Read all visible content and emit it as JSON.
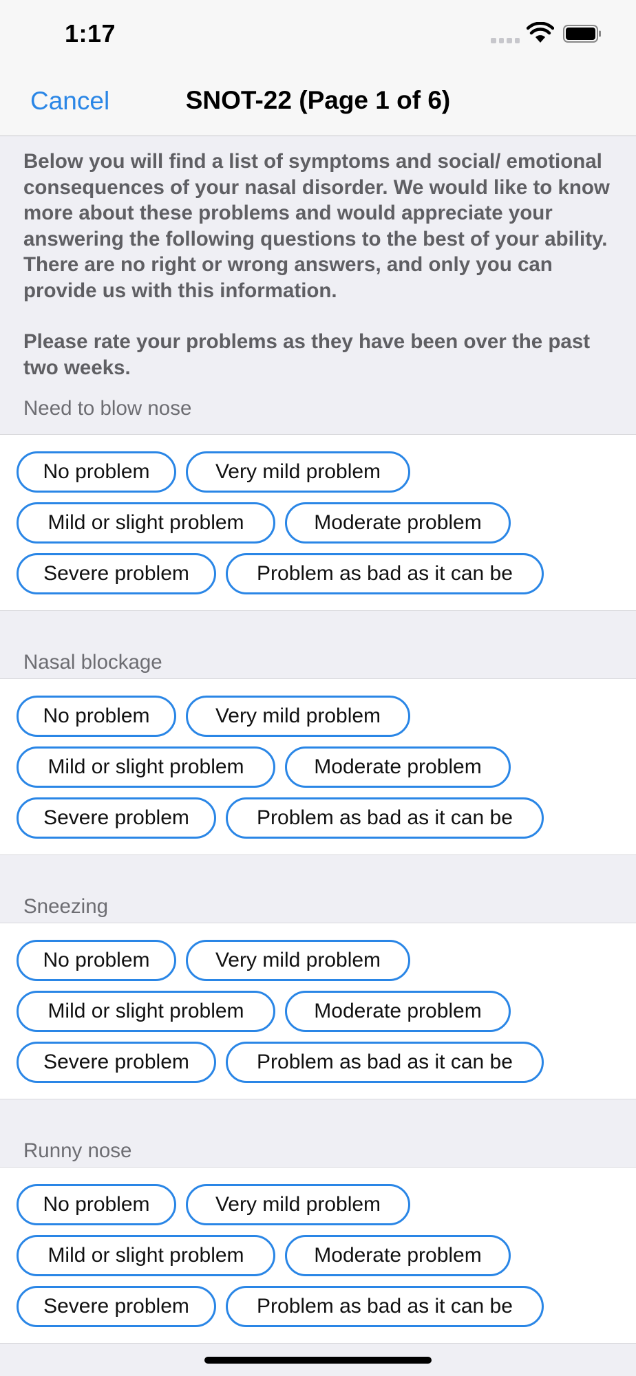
{
  "status_bar": {
    "time": "1:17",
    "icons": [
      "cellular-signal-icon",
      "wifi-icon",
      "battery-icon"
    ]
  },
  "nav": {
    "cancel_label": "Cancel",
    "title": "SNOT-22 (Page 1 of 6)"
  },
  "intro": {
    "paragraph1": "Below you will find a list of symptoms and social/ emotional consequences of your nasal disorder. We would like to know more about these problems and would appreciate your answering the following questions to the best of your ability. There are no right or wrong answers, and only you can provide us with this information.",
    "paragraph2": "Please rate your problems as they have been over the past two weeks."
  },
  "options": [
    "No problem",
    "Very mild problem",
    "Mild or slight problem",
    "Moderate problem",
    "Severe problem",
    "Problem as bad as it can be"
  ],
  "questions": [
    {
      "label": "Need to blow nose"
    },
    {
      "label": "Nasal blockage"
    },
    {
      "label": "Sneezing"
    },
    {
      "label": "Runny nose"
    }
  ],
  "colors": {
    "accent": "#2a86e6",
    "background": "#efeff4",
    "card": "#ffffff",
    "header_text": "#6d6d72",
    "intro_text": "#5f5f63"
  }
}
